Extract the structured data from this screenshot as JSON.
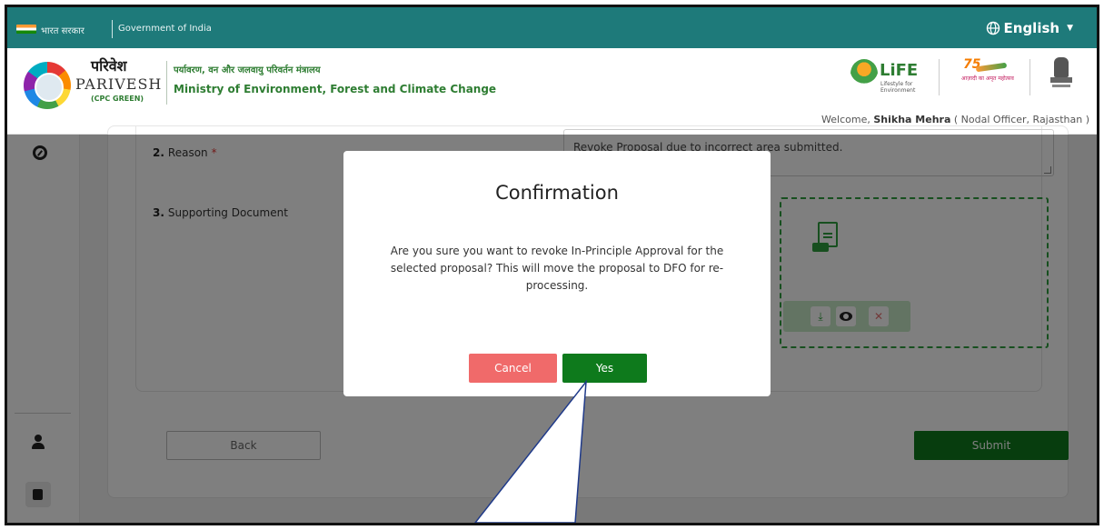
{
  "gov_bar": {
    "hindi": "भारत सरकार",
    "english": "Government of India",
    "language": "English"
  },
  "header": {
    "brand_hindi": "परिवेश",
    "brand_english": "PARIVESH",
    "brand_sub": "(CPC GREEN)",
    "ministry_hindi": "पर्यावरण, वन और जलवायु परिवर्तन मंत्रालय",
    "ministry_english": "Ministry of Environment, Forest and Climate Change",
    "life_logo": "LiFE",
    "life_sub": "Lifestyle for Environment",
    "azadi_text": "आज़ादी का अमृत महोत्सव",
    "welcome_prefix": "Welcome,",
    "user_name": "Shikha Mehra",
    "user_role": "( Nodal Officer,  Rajasthan )"
  },
  "sidebar": {
    "icons": [
      "dashboard-gauge-icon",
      "user-icon",
      "logout-icon"
    ]
  },
  "form": {
    "reason_num": "2.",
    "reason_label": "Reason",
    "required_mark": "*",
    "reason_value": "Revoke Proposal due to incorrect area submitted.",
    "doc_num": "3.",
    "doc_label": "Supporting Document",
    "back_label": "Back",
    "submit_label": "Submit"
  },
  "modal": {
    "title": "Confirmation",
    "message": "Are you sure you want to revoke In-Principle Approval for the selected proposal? This will move the proposal to DFO for re-processing.",
    "cancel_label": "Cancel",
    "yes_label": "Yes"
  },
  "colors": {
    "topbar": "#1e7a7a",
    "primary_green": "#0e7a1c",
    "cancel_red": "#f06a6a",
    "callout_stroke": "#1f3a8a"
  }
}
